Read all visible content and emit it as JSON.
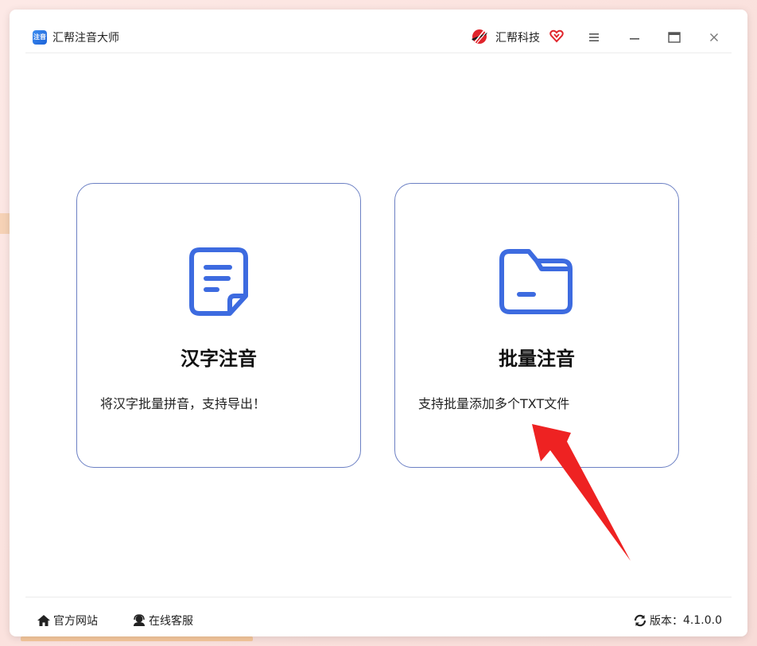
{
  "app": {
    "title": "汇帮注音大师",
    "logo_text": "注音"
  },
  "header": {
    "brand_name": "汇帮科技"
  },
  "cards": [
    {
      "title": "汉字注音",
      "description": "将汉字批量拼音，支持导出！",
      "icon": "document-icon"
    },
    {
      "title": "批量注音",
      "description": "支持批量添加多个TXT文件",
      "icon": "folder-icon"
    }
  ],
  "footer": {
    "website_label": "官方网站",
    "service_label": "在线客服",
    "version_label": "版本：",
    "version_value": "4.1.0.0"
  },
  "colors": {
    "accent": "#3d6be0",
    "card_border": "#6c80c4",
    "arrow": "#ee2222",
    "brand_red": "#e0242b"
  }
}
